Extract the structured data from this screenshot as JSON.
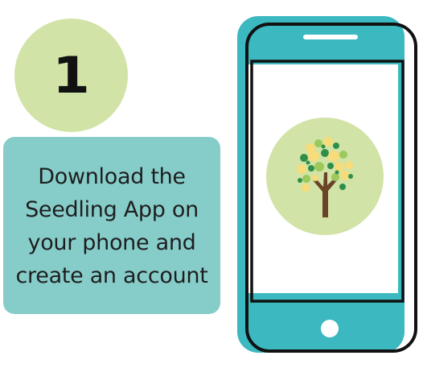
{
  "step": {
    "number": "1"
  },
  "instruction": {
    "lines": [
      "Download the",
      "Seedling App on",
      "your phone and",
      "create an account"
    ]
  },
  "colors": {
    "step_circle": "#d1e3a6",
    "instruction_box": "#86cdca",
    "phone_body": "#3bb8c0",
    "phone_outline": "#111111",
    "screen": "#ffffff",
    "app_icon_circle": "#d1e3a6",
    "tree_trunk": "#6b4428"
  },
  "icons": {
    "phone": "smartphone-icon",
    "app_logo": "tree-icon",
    "home_button": "home-button-icon",
    "speaker": "speaker-slot-icon"
  }
}
